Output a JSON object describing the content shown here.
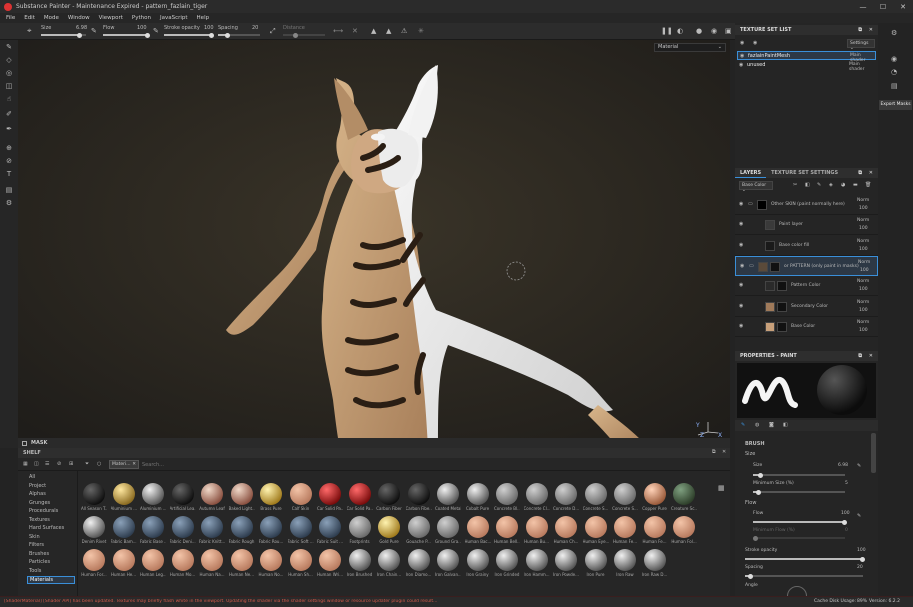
{
  "app": {
    "title": "Substance Painter - Maintenance Expired - pattern_fazlain_tiger",
    "window_controls": [
      "—",
      "☐",
      "✕"
    ]
  },
  "menu": [
    "File",
    "Edit",
    "Mode",
    "Window",
    "Viewport",
    "Python",
    "JavaScript",
    "Help"
  ],
  "toolbar": {
    "size_label": "Size",
    "size_value": "6.98",
    "flow_label": "Flow",
    "flow_value": "100",
    "stroke_opacity_label": "Stroke opacity",
    "stroke_opacity_value": "100",
    "spacing_label": "Spacing",
    "spacing_value": "20",
    "distance_label": "Distance"
  },
  "viewport": {
    "mode_select": "Material",
    "mask_label": "MASK"
  },
  "texture_set_list": {
    "title": "TEXTURE SET LIST",
    "settings_label": "Settings",
    "items": [
      {
        "name": "fazlainPaintMesh",
        "shader": "Main shader"
      },
      {
        "name": "unused",
        "shader": "Main shader"
      }
    ]
  },
  "layers": {
    "tab_layers": "LAYERS",
    "tab_texture_set_settings": "TEXTURE SET SETTINGS",
    "channel_select": "Base Color",
    "items": [
      {
        "name": "Other SKIN (paint normally here)",
        "blend": "Norm",
        "opacity": "100",
        "type": "folder"
      },
      {
        "name": "Paint layer",
        "blend": "Norm",
        "opacity": "100",
        "type": "paint"
      },
      {
        "name": "Base color fill",
        "blend": "Norm",
        "opacity": "100",
        "type": "fill"
      },
      {
        "name": "or PATTERN (only paint in masks)",
        "blend": "Norm",
        "opacity": "100",
        "type": "folder"
      },
      {
        "name": "Pattern Color",
        "blend": "Norm",
        "opacity": "100",
        "type": "fill"
      },
      {
        "name": "Secondary Color",
        "blend": "Norm",
        "opacity": "100",
        "type": "fill"
      },
      {
        "name": "Base Color",
        "blend": "Norm",
        "opacity": "100",
        "type": "fill"
      }
    ]
  },
  "properties": {
    "title": "PROPERTIES - PAINT",
    "brush_section": "BRUSH",
    "size_section": "Size",
    "size_label": "Size",
    "size_value": "6.98",
    "min_size_label": "Minimum Size (%)",
    "min_size_value": "5",
    "flow_section": "Flow",
    "flow_label": "Flow",
    "flow_value": "100",
    "min_flow_label": "Minimum Flow (%)",
    "min_flow_value": "0",
    "stroke_opacity_label": "Stroke opacity",
    "stroke_opacity_value": "100",
    "spacing_label": "Spacing",
    "spacing_value": "20",
    "angle_label": "Angle"
  },
  "export": {
    "label": "Export Masks"
  },
  "shelf": {
    "title": "SHELF",
    "filter_tag": "Materi...",
    "search_placeholder": "Search...",
    "categories": [
      "All",
      "Project",
      "Alphas",
      "Grunges",
      "Procedurals",
      "Textures",
      "Hard Surfaces",
      "Skin",
      "Filters",
      "Brushes",
      "Particles",
      "Tools",
      "Materials"
    ],
    "selected_category": "Materials",
    "materials_row1": [
      "All Season T...",
      "Aluminium ...",
      "Aluminium ...",
      "Artificial Lea...",
      "Autumn Leaf",
      "Baked Light...",
      "Brass Pure",
      "Calf Skin",
      "Car Solid Pa...",
      "Car Solid Pa...",
      "Carbon Fiber",
      "Carbon Fibe...",
      "Coated Metal",
      "Cobalt Pure",
      "Concrete Bl...",
      "Concrete Cl...",
      "Concrete D...",
      "Concrete S...",
      "Concrete S...",
      "Copper Pure",
      "Creature Sc..."
    ],
    "materials_row2": [
      "Denim Rivet",
      "Fabric Bam...",
      "Fabric Base ...",
      "Fabric Deni...",
      "Fabric Knitt...",
      "Fabric Rough",
      "Fabric Rou...",
      "Fabric Soft ...",
      "Fabric Suit ...",
      "Footprints",
      "Gold Pure",
      "Gouache P...",
      "Ground Gra...",
      "Human Bac...",
      "Human Bell...",
      "Human Bu...",
      "Human Ch...",
      "Human Eye...",
      "Human Fe...",
      "Human Fe...",
      "Human Fol..."
    ],
    "materials_row3": [
      "Human For...",
      "Human He...",
      "Human Leg...",
      "Human Mo...",
      "Human Na...",
      "Human Ne...",
      "Human No...",
      "Human Sh...",
      "Human Wri...",
      "Iron Brushed",
      "Iron Chain...",
      "Iron Diamo...",
      "Iron Galvan...",
      "Iron Grainy",
      "Iron Grinded",
      "Iron Hamm...",
      "Iron Powde...",
      "Iron Pure",
      "Iron Raw",
      "Iron Raw D..."
    ]
  },
  "status": {
    "message": "[ShaderMaterial] [Shader API] has been updated. Textures may briefly flash white in the viewport. Updating the shader via the shader settings window or resource updater plugin could result...",
    "disk_usage": "Cache Disk Usage:",
    "disk_value": "89%",
    "version": "Version: 6.2.2"
  },
  "colors": {
    "accent": "#3a8fd9",
    "skin": "#c9a57c",
    "white_paint": "#e8e8e8"
  }
}
